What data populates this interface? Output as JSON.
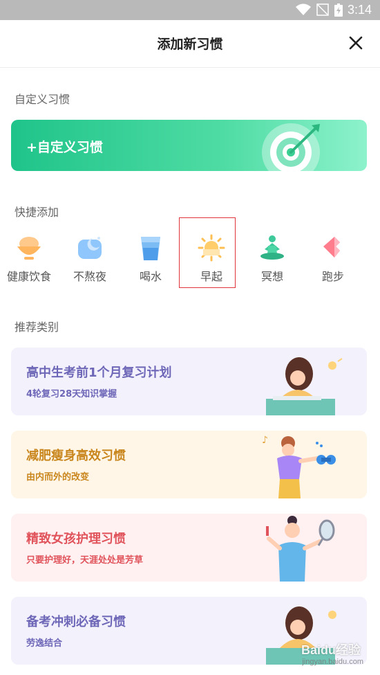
{
  "status_bar": {
    "time": "3:14"
  },
  "header": {
    "title": "添加新习惯"
  },
  "custom_section": {
    "label": "自定义习惯",
    "button_label": "+自定义习惯"
  },
  "quick_section": {
    "label": "快捷添加",
    "items": [
      {
        "label": "健康饮食",
        "icon": "bowl-icon"
      },
      {
        "label": "不熬夜",
        "icon": "moon-icon"
      },
      {
        "label": "喝水",
        "icon": "cup-icon"
      },
      {
        "label": "早起",
        "icon": "sun-icon"
      },
      {
        "label": "冥想",
        "icon": "meditation-icon"
      },
      {
        "label": "跑步",
        "icon": "shoe-icon"
      }
    ]
  },
  "recommend_section": {
    "label": "推荐类别",
    "cards": [
      {
        "title": "高中生考前1个月复习计划",
        "subtitle": "4轮复习28天知识掌握",
        "bg": "#f2f1fc",
        "color": "#6e67b8"
      },
      {
        "title": "减肥瘦身高效习惯",
        "subtitle": "由内而外的改变",
        "bg": "#fff6e8",
        "color": "#c9861d"
      },
      {
        "title": "精致女孩护理习惯",
        "subtitle": "只要护理好，天涯处处是芳草",
        "bg": "#fff0f1",
        "color": "#e0535b"
      },
      {
        "title": "备考冲刺必备习惯",
        "subtitle": "劳逸结合",
        "bg": "#f2f1fc",
        "color": "#6e67b8"
      }
    ]
  },
  "watermark": {
    "brand": "Baidu经验",
    "url": "jingyan.baidu.com"
  }
}
